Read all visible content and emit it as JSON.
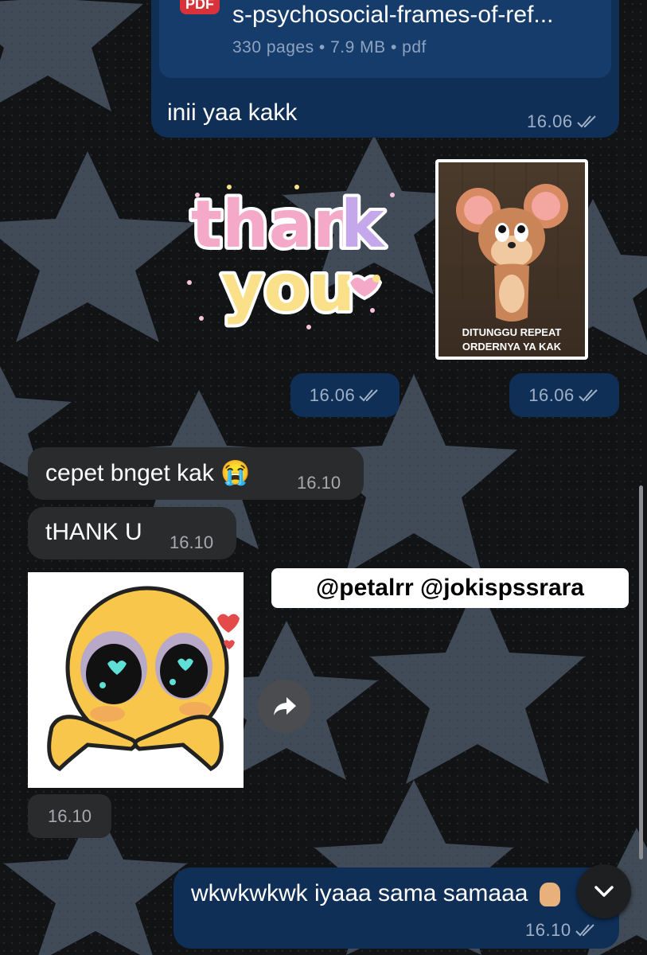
{
  "doc": {
    "badge": "PDF",
    "filename": "s-psychosocial-frames-of-ref...",
    "meta": "330 pages • 7.9 MB • pdf"
  },
  "messages": {
    "doc_caption": "inii yaa kakk",
    "doc_time": "16.06",
    "sticker_thanks_text": "thank you",
    "sticker_thanks_time": "16.06",
    "sticker_jerry_caption_1": "DITUNGGU REPEAT",
    "sticker_jerry_caption_2": "ORDERNYA YA KAK",
    "sticker_jerry_time": "16.06",
    "in_1_text": "cepet bnget kak 😭",
    "in_1_time": "16.10",
    "in_2_text": "tHANK U",
    "in_2_time": "16.10",
    "sticker_face_time": "16.10",
    "out_last_text": "wkwkwkwk iyaaa sama samaaa",
    "out_last_time": "16.10"
  },
  "watermark": "@petalrr @jokispssrara",
  "colors": {
    "outgoing": "#0f2f57",
    "incoming": "#2a2b2d",
    "background": "#111214",
    "star": "#4a5563",
    "pdf_badge": "#d8333b"
  },
  "icons": {
    "read_receipt": "double-check-icon",
    "forward": "forward-icon",
    "scroll_down": "chevron-down-icon"
  }
}
